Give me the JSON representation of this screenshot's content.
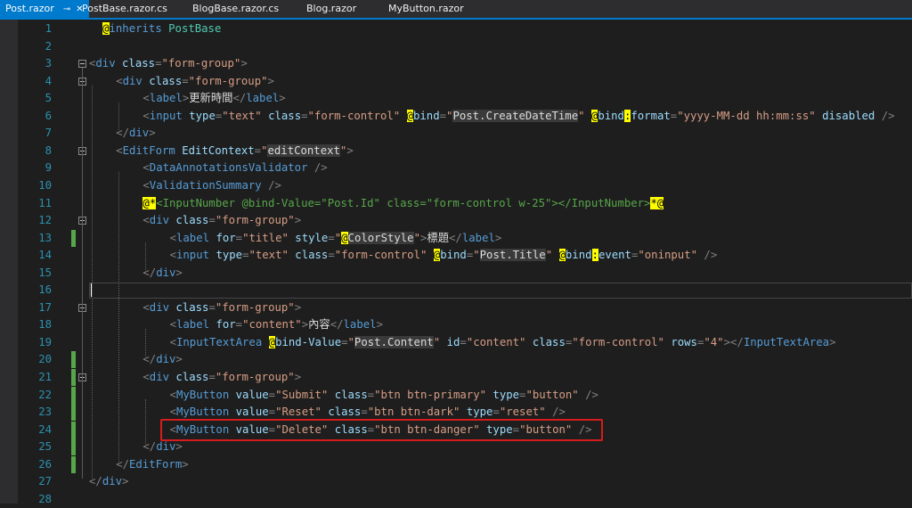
{
  "tabs": [
    {
      "label": "Post.razor",
      "active": true
    },
    {
      "label": "PostBase.razor.cs",
      "active": false
    },
    {
      "label": "BlogBase.razor.cs",
      "active": false
    },
    {
      "label": "Blog.razor",
      "active": false
    },
    {
      "label": "MyButton.razor",
      "active": false
    }
  ],
  "tab_icons": {
    "pin": "pin-icon",
    "close": "close-icon"
  },
  "colors": {
    "background": "#1e1e1e",
    "tag_bracket": "#808080",
    "tag_name": "#569cd6",
    "attribute": "#9cdcfe",
    "string": "#d69d85",
    "comment": "#57a64a",
    "razor_marker": "#ffff00",
    "highlight_border": "#d61c1c",
    "active_tab": "#007acc",
    "change_bar": "#57a64a"
  },
  "lines": [
    {
      "n": "1",
      "indent": 2,
      "tokens": [
        [
          "rz",
          "@"
        ],
        [
          "tn",
          "inherits"
        ],
        [
          "tx",
          " "
        ],
        [
          "cp",
          "PostBase"
        ]
      ]
    },
    {
      "n": "2",
      "indent": 0,
      "tokens": []
    },
    {
      "n": "3",
      "indent": 0,
      "fold": true,
      "tokens": [
        [
          "tg",
          "<"
        ],
        [
          "tn",
          "div"
        ],
        [
          "tx",
          " "
        ],
        [
          "at",
          "class"
        ],
        [
          "tg",
          "="
        ],
        [
          "st",
          "\"form-group\""
        ],
        [
          "tg",
          ">"
        ]
      ]
    },
    {
      "n": "4",
      "indent": 4,
      "fold": true,
      "tokens": [
        [
          "tg",
          "<"
        ],
        [
          "tn",
          "div"
        ],
        [
          "tx",
          " "
        ],
        [
          "at",
          "class"
        ],
        [
          "tg",
          "="
        ],
        [
          "st",
          "\"form-group\""
        ],
        [
          "tg",
          ">"
        ]
      ]
    },
    {
      "n": "5",
      "indent": 8,
      "tokens": [
        [
          "tg",
          "<"
        ],
        [
          "tn",
          "label"
        ],
        [
          "tg",
          ">"
        ],
        [
          "tx",
          "更新時間"
        ],
        [
          "tg",
          "</"
        ],
        [
          "tn",
          "label"
        ],
        [
          "tg",
          ">"
        ]
      ]
    },
    {
      "n": "6",
      "indent": 8,
      "tokens": [
        [
          "tg",
          "<"
        ],
        [
          "tn",
          "input"
        ],
        [
          "tx",
          " "
        ],
        [
          "at",
          "type"
        ],
        [
          "tg",
          "="
        ],
        [
          "st",
          "\"text\""
        ],
        [
          "tx",
          " "
        ],
        [
          "at",
          "class"
        ],
        [
          "tg",
          "="
        ],
        [
          "st",
          "\"form-control\""
        ],
        [
          "tx",
          " "
        ],
        [
          "rz",
          "@"
        ],
        [
          "at",
          "bind"
        ],
        [
          "tg",
          "="
        ],
        [
          "st",
          "\""
        ],
        [
          "bg",
          "Post.CreateDateTime"
        ],
        [
          "st",
          "\""
        ],
        [
          "tx",
          " "
        ],
        [
          "rz",
          "@"
        ],
        [
          "at",
          "bind"
        ],
        [
          "rz",
          ":"
        ],
        [
          "at",
          "format"
        ],
        [
          "tg",
          "="
        ],
        [
          "st",
          "\"yyyy-MM-dd hh:mm:ss\""
        ],
        [
          "tx",
          " "
        ],
        [
          "at",
          "disabled"
        ],
        [
          "tx",
          " "
        ],
        [
          "tg",
          "/>"
        ]
      ]
    },
    {
      "n": "7",
      "indent": 4,
      "tokens": [
        [
          "tg",
          "</"
        ],
        [
          "tn",
          "div"
        ],
        [
          "tg",
          ">"
        ]
      ]
    },
    {
      "n": "8",
      "indent": 4,
      "fold": true,
      "tokens": [
        [
          "tg",
          "<"
        ],
        [
          "tn",
          "EditForm"
        ],
        [
          "tx",
          " "
        ],
        [
          "at",
          "EditContext"
        ],
        [
          "tg",
          "="
        ],
        [
          "st",
          "\""
        ],
        [
          "bg",
          "editContext"
        ],
        [
          "st",
          "\""
        ],
        [
          "tg",
          ">"
        ]
      ]
    },
    {
      "n": "9",
      "indent": 8,
      "tokens": [
        [
          "tg",
          "<"
        ],
        [
          "tn",
          "DataAnnotationsValidator"
        ],
        [
          "tx",
          " "
        ],
        [
          "tg",
          "/>"
        ]
      ]
    },
    {
      "n": "10",
      "indent": 8,
      "tokens": [
        [
          "tg",
          "<"
        ],
        [
          "tn",
          "ValidationSummary"
        ],
        [
          "tx",
          " "
        ],
        [
          "tg",
          "/>"
        ]
      ]
    },
    {
      "n": "11",
      "indent": 8,
      "tokens": [
        [
          "rz",
          "@*"
        ],
        [
          "cm",
          "<InputNumber @bind-Value=\"Post.Id\" class=\"form-control w-25\"></InputNumber>"
        ],
        [
          "rz",
          "*@"
        ]
      ]
    },
    {
      "n": "12",
      "indent": 8,
      "fold": true,
      "tokens": [
        [
          "tg",
          "<"
        ],
        [
          "tn",
          "div"
        ],
        [
          "tx",
          " "
        ],
        [
          "at",
          "class"
        ],
        [
          "tg",
          "="
        ],
        [
          "st",
          "\"form-group\""
        ],
        [
          "tg",
          ">"
        ]
      ]
    },
    {
      "n": "13",
      "indent": 12,
      "changed": true,
      "tokens": [
        [
          "tg",
          "<"
        ],
        [
          "tn",
          "label"
        ],
        [
          "tx",
          " "
        ],
        [
          "at",
          "for"
        ],
        [
          "tg",
          "="
        ],
        [
          "st",
          "\"title\""
        ],
        [
          "tx",
          " "
        ],
        [
          "at",
          "style"
        ],
        [
          "tg",
          "="
        ],
        [
          "st",
          "\""
        ],
        [
          "rz",
          "@"
        ],
        [
          "bg",
          "ColorStyle"
        ],
        [
          "st",
          "\""
        ],
        [
          "tg",
          ">"
        ],
        [
          "tx",
          "標題"
        ],
        [
          "tg",
          "</"
        ],
        [
          "tn",
          "label"
        ],
        [
          "tg",
          ">"
        ]
      ]
    },
    {
      "n": "14",
      "indent": 12,
      "tokens": [
        [
          "tg",
          "<"
        ],
        [
          "tn",
          "input"
        ],
        [
          "tx",
          " "
        ],
        [
          "at",
          "type"
        ],
        [
          "tg",
          "="
        ],
        [
          "st",
          "\"text\""
        ],
        [
          "tx",
          " "
        ],
        [
          "at",
          "class"
        ],
        [
          "tg",
          "="
        ],
        [
          "st",
          "\"form-control\""
        ],
        [
          "tx",
          " "
        ],
        [
          "rz",
          "@"
        ],
        [
          "at",
          "bind"
        ],
        [
          "tg",
          "="
        ],
        [
          "st",
          "\""
        ],
        [
          "bg",
          "Post.Title"
        ],
        [
          "st",
          "\""
        ],
        [
          "tx",
          " "
        ],
        [
          "rz",
          "@"
        ],
        [
          "at",
          "bind"
        ],
        [
          "rz",
          ":"
        ],
        [
          "at",
          "event"
        ],
        [
          "tg",
          "="
        ],
        [
          "st",
          "\"oninput\""
        ],
        [
          "tx",
          " "
        ],
        [
          "tg",
          "/>"
        ]
      ]
    },
    {
      "n": "15",
      "indent": 8,
      "tokens": [
        [
          "tg",
          "</"
        ],
        [
          "tn",
          "div"
        ],
        [
          "tg",
          ">"
        ]
      ]
    },
    {
      "n": "16",
      "indent": 0,
      "current": true,
      "tokens": []
    },
    {
      "n": "17",
      "indent": 8,
      "fold": true,
      "tokens": [
        [
          "tg",
          "<"
        ],
        [
          "tn",
          "div"
        ],
        [
          "tx",
          " "
        ],
        [
          "at",
          "class"
        ],
        [
          "tg",
          "="
        ],
        [
          "st",
          "\"form-group\""
        ],
        [
          "tg",
          ">"
        ]
      ]
    },
    {
      "n": "18",
      "indent": 12,
      "tokens": [
        [
          "tg",
          "<"
        ],
        [
          "tn",
          "label"
        ],
        [
          "tx",
          " "
        ],
        [
          "at",
          "for"
        ],
        [
          "tg",
          "="
        ],
        [
          "st",
          "\"content\""
        ],
        [
          "tg",
          ">"
        ],
        [
          "tx",
          "內容"
        ],
        [
          "tg",
          "</"
        ],
        [
          "tn",
          "label"
        ],
        [
          "tg",
          ">"
        ]
      ]
    },
    {
      "n": "19",
      "indent": 12,
      "tokens": [
        [
          "tg",
          "<"
        ],
        [
          "tn",
          "InputTextArea"
        ],
        [
          "tx",
          " "
        ],
        [
          "rz",
          "@"
        ],
        [
          "at",
          "bind-Value"
        ],
        [
          "tg",
          "="
        ],
        [
          "st",
          "\""
        ],
        [
          "bg",
          "Post.Content"
        ],
        [
          "st",
          "\""
        ],
        [
          "tx",
          " "
        ],
        [
          "at",
          "id"
        ],
        [
          "tg",
          "="
        ],
        [
          "st",
          "\"content\""
        ],
        [
          "tx",
          " "
        ],
        [
          "at",
          "class"
        ],
        [
          "tg",
          "="
        ],
        [
          "st",
          "\"form-control\""
        ],
        [
          "tx",
          " "
        ],
        [
          "at",
          "rows"
        ],
        [
          "tg",
          "="
        ],
        [
          "st",
          "\"4\""
        ],
        [
          "tg",
          "></"
        ],
        [
          "tn",
          "InputTextArea"
        ],
        [
          "tg",
          ">"
        ]
      ]
    },
    {
      "n": "20",
      "indent": 8,
      "changed": true,
      "tokens": [
        [
          "tg",
          "</"
        ],
        [
          "tn",
          "div"
        ],
        [
          "tg",
          ">"
        ]
      ]
    },
    {
      "n": "21",
      "indent": 8,
      "changed": true,
      "fold": true,
      "tokens": [
        [
          "tg",
          "<"
        ],
        [
          "tn",
          "div"
        ],
        [
          "tx",
          " "
        ],
        [
          "at",
          "class"
        ],
        [
          "tg",
          "="
        ],
        [
          "st",
          "\"form-group\""
        ],
        [
          "tg",
          ">"
        ]
      ]
    },
    {
      "n": "22",
      "indent": 12,
      "changed": true,
      "tokens": [
        [
          "tg",
          "<"
        ],
        [
          "tn",
          "MyButton"
        ],
        [
          "tx",
          " "
        ],
        [
          "at",
          "value"
        ],
        [
          "tg",
          "="
        ],
        [
          "st",
          "\"Submit\""
        ],
        [
          "tx",
          " "
        ],
        [
          "at",
          "class"
        ],
        [
          "tg",
          "="
        ],
        [
          "st",
          "\"btn btn-primary\""
        ],
        [
          "tx",
          " "
        ],
        [
          "at",
          "type"
        ],
        [
          "tg",
          "="
        ],
        [
          "st",
          "\"button\""
        ],
        [
          "tx",
          " "
        ],
        [
          "tg",
          "/>"
        ]
      ]
    },
    {
      "n": "23",
      "indent": 12,
      "changed": true,
      "tokens": [
        [
          "tg",
          "<"
        ],
        [
          "tn",
          "MyButton"
        ],
        [
          "tx",
          " "
        ],
        [
          "at",
          "value"
        ],
        [
          "tg",
          "="
        ],
        [
          "st",
          "\"Reset\""
        ],
        [
          "tx",
          " "
        ],
        [
          "at",
          "class"
        ],
        [
          "tg",
          "="
        ],
        [
          "st",
          "\"btn btn-dark\""
        ],
        [
          "tx",
          " "
        ],
        [
          "at",
          "type"
        ],
        [
          "tg",
          "="
        ],
        [
          "st",
          "\"reset\""
        ],
        [
          "tx",
          " "
        ],
        [
          "tg",
          "/>"
        ]
      ]
    },
    {
      "n": "24",
      "indent": 12,
      "changed": true,
      "tokens": [
        [
          "tg",
          "<"
        ],
        [
          "tn",
          "MyButton"
        ],
        [
          "tx",
          " "
        ],
        [
          "at",
          "value"
        ],
        [
          "tg",
          "="
        ],
        [
          "st",
          "\"Delete\""
        ],
        [
          "tx",
          " "
        ],
        [
          "at",
          "class"
        ],
        [
          "tg",
          "="
        ],
        [
          "st",
          "\"btn btn-danger\""
        ],
        [
          "tx",
          " "
        ],
        [
          "at",
          "type"
        ],
        [
          "tg",
          "="
        ],
        [
          "st",
          "\"button\""
        ],
        [
          "tx",
          " "
        ],
        [
          "tg",
          "/>"
        ]
      ]
    },
    {
      "n": "25",
      "indent": 8,
      "changed": true,
      "tokens": [
        [
          "tg",
          "</"
        ],
        [
          "tn",
          "div"
        ],
        [
          "tg",
          ">"
        ]
      ]
    },
    {
      "n": "26",
      "indent": 4,
      "changed": true,
      "tokens": [
        [
          "tg",
          "</"
        ],
        [
          "tn",
          "EditForm"
        ],
        [
          "tg",
          ">"
        ]
      ]
    },
    {
      "n": "27",
      "indent": 0,
      "tokens": [
        [
          "tg",
          "</"
        ],
        [
          "tn",
          "div"
        ],
        [
          "tg",
          ">"
        ]
      ]
    },
    {
      "n": "28",
      "indent": 0,
      "tokens": []
    }
  ]
}
